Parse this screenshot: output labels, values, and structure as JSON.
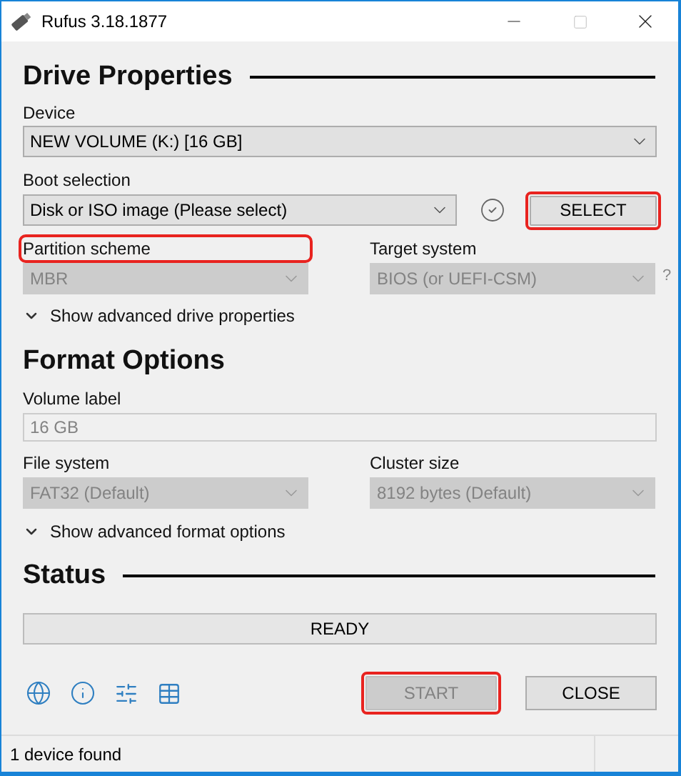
{
  "window": {
    "title": "Rufus 3.18.1877"
  },
  "drive_properties": {
    "heading": "Drive Properties",
    "device": {
      "label": "Device",
      "value": "NEW VOLUME (K:) [16 GB]",
      "disabled": false
    },
    "boot_selection": {
      "label": "Boot selection",
      "value": "Disk or ISO image (Please select)",
      "disabled": false,
      "button": {
        "label": "SELECT",
        "highlighted": true
      }
    },
    "partition_scheme": {
      "label": "Partition scheme",
      "label_highlighted": true,
      "value": "MBR",
      "disabled": true
    },
    "target_system": {
      "label": "Target system",
      "label_highlighted": false,
      "value": "BIOS (or UEFI-CSM)",
      "disabled": true,
      "help": "?"
    },
    "advanced": {
      "label": "Show advanced drive properties",
      "expanded": false
    }
  },
  "format_options": {
    "heading": "Format Options",
    "volume_label": {
      "label": "Volume label",
      "value": "16 GB",
      "disabled": true
    },
    "file_system": {
      "label": "File system",
      "label_highlighted": false,
      "value": "FAT32 (Default)",
      "disabled": true
    },
    "cluster_size": {
      "label": "Cluster size",
      "label_highlighted": false,
      "value": "8192 bytes (Default)",
      "disabled": true
    },
    "advanced": {
      "label": "Show advanced format options",
      "expanded": false
    }
  },
  "status": {
    "heading": "Status",
    "text": "READY",
    "level": 0
  },
  "buttons": [
    {
      "label": "START",
      "disabled": true,
      "highlighted": true
    },
    {
      "label": "CLOSE",
      "disabled": false,
      "highlighted": false
    }
  ],
  "status_bar": {
    "text": "1 device found"
  }
}
